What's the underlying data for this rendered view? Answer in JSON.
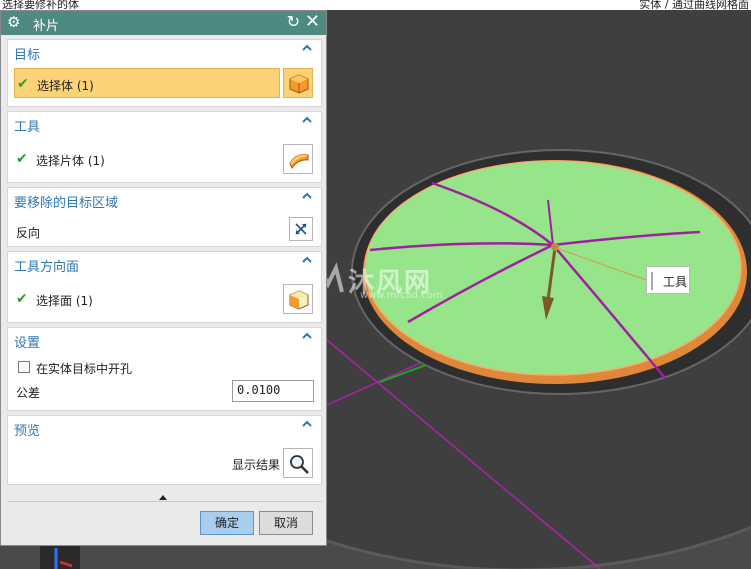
{
  "top_strip": {
    "left_text": "选择要修补的体",
    "right_text": "实体 / 通过曲线网格面"
  },
  "dialog": {
    "title": "补片",
    "target": {
      "header": "目标",
      "select_label": "选择体 (1)"
    },
    "tool": {
      "header": "工具",
      "select_label": "选择片体 (1)"
    },
    "remove_region": {
      "header": "要移除的目标区域",
      "reverse_label": "反向"
    },
    "tool_direction": {
      "header": "工具方向面",
      "select_label": "选择面 (1)"
    },
    "settings": {
      "header": "设置",
      "checkbox_label": "在实体目标中开孔",
      "checkbox_checked": false,
      "tolerance_label": "公差",
      "tolerance_value": "0.0100"
    },
    "preview": {
      "header": "预览",
      "show_result_label": "显示结果"
    },
    "ok_label": "确定",
    "cancel_label": "取消"
  },
  "viewport": {
    "tool_tag": "工具"
  },
  "watermark": {
    "text": "沐风网",
    "url": "www.mfcad.com"
  },
  "colors": {
    "title_bar": "#4e8a82",
    "header_blue": "#2f78b3",
    "selected_row": "#fbd276",
    "disc_fill": "#96e58a",
    "disc_rim": "#e0883a",
    "curve_purple": "#a020a0",
    "background": "#4a4a4a"
  }
}
